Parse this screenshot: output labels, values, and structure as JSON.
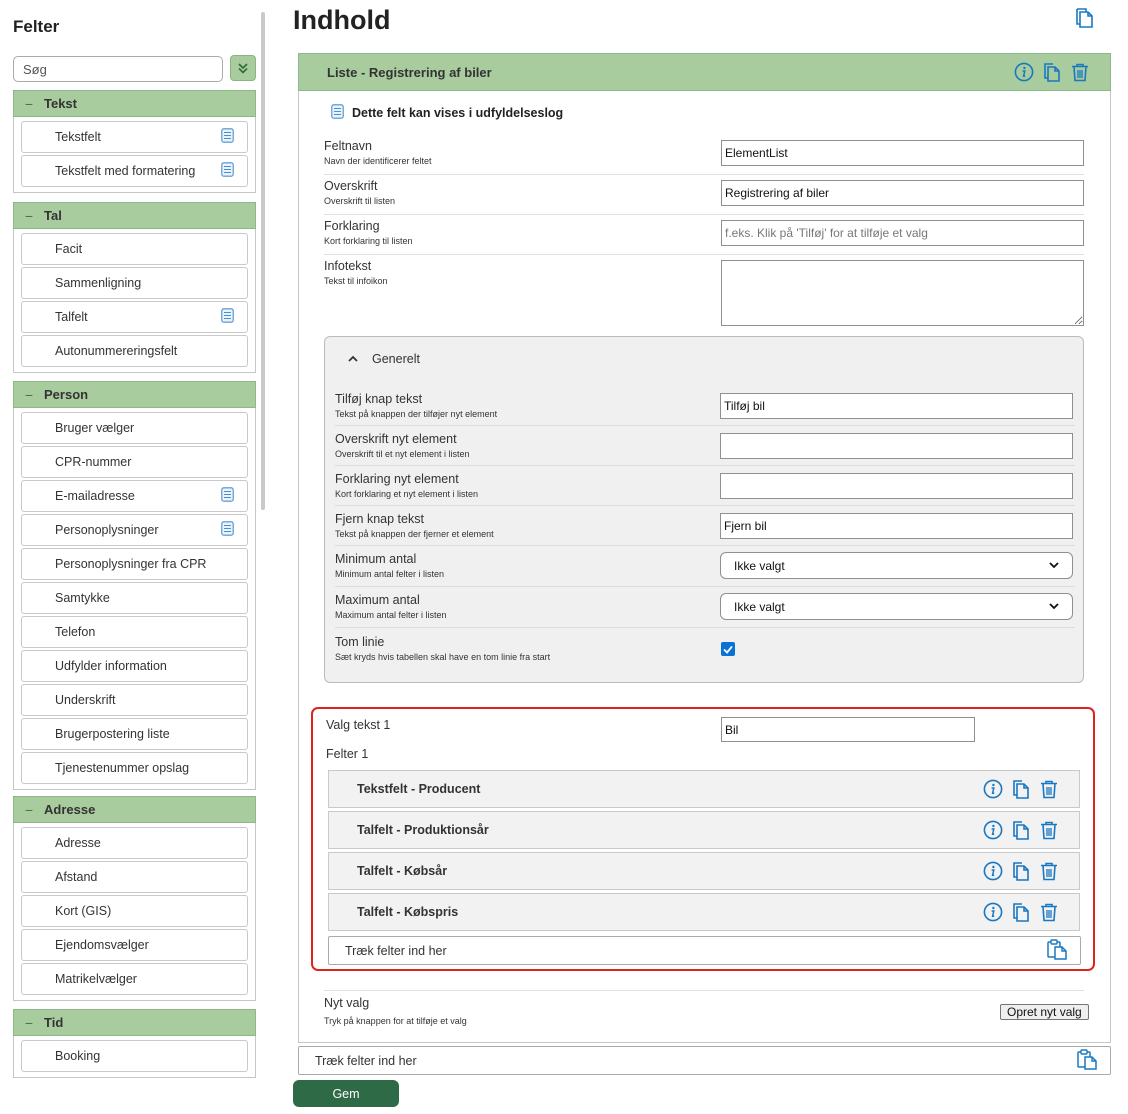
{
  "sidebar": {
    "title": "Felter",
    "search_placeholder": "Søg",
    "groups": [
      {
        "label": "Tekst",
        "items": [
          {
            "label": "Tekstfelt",
            "log": true
          },
          {
            "label": "Tekstfelt med formatering",
            "log": true
          }
        ]
      },
      {
        "label": "Tal",
        "items": [
          {
            "label": "Facit"
          },
          {
            "label": "Sammenligning"
          },
          {
            "label": "Talfelt",
            "log": true
          },
          {
            "label": "Autonummereringsfelt"
          }
        ]
      },
      {
        "label": "Person",
        "items": [
          {
            "label": "Bruger vælger"
          },
          {
            "label": "CPR-nummer"
          },
          {
            "label": "E-mailadresse",
            "log": true
          },
          {
            "label": "Personoplysninger",
            "log": true
          },
          {
            "label": "Personoplysninger fra CPR"
          },
          {
            "label": "Samtykke"
          },
          {
            "label": "Telefon"
          },
          {
            "label": "Udfylder information"
          },
          {
            "label": "Underskrift"
          },
          {
            "label": "Brugerpostering liste"
          },
          {
            "label": "Tjenestenummer opslag"
          }
        ]
      },
      {
        "label": "Adresse",
        "items": [
          {
            "label": "Adresse"
          },
          {
            "label": "Afstand"
          },
          {
            "label": "Kort (GIS)"
          },
          {
            "label": "Ejendomsvælger"
          },
          {
            "label": "Matrikelvælger"
          }
        ]
      },
      {
        "label": "Tid",
        "items": [
          {
            "label": "Booking"
          }
        ]
      }
    ]
  },
  "main": {
    "title": "Indhold",
    "list": {
      "title": "Liste - Registrering af biler",
      "log_notice": "Dette felt kan vises i udfyldelseslog",
      "fields": {
        "feltnavn": {
          "label": "Feltnavn",
          "sub": "Navn der identificerer feltet",
          "value": "ElementList"
        },
        "overskrift": {
          "label": "Overskrift",
          "sub": "Overskrift til listen",
          "value": "Registrering af biler"
        },
        "forklaring": {
          "label": "Forklaring",
          "sub": "Kort forklaring til listen",
          "placeholder": "f.eks. Klik på 'Tilføj' for at tilføje et valg"
        },
        "infotekst": {
          "label": "Infotekst",
          "sub": "Tekst til infoikon",
          "value": ""
        }
      },
      "general": {
        "title": "Generelt",
        "tilfoej": {
          "label": "Tilføj knap tekst",
          "sub": "Tekst på knappen der tilføjer nyt element",
          "value": "Tilføj bil"
        },
        "overskrift_nyt": {
          "label": "Overskrift nyt element",
          "sub": "Overskrift til et nyt element i listen",
          "value": ""
        },
        "forklaring_nyt": {
          "label": "Forklaring nyt element",
          "sub": "Kort forklaring et nyt element i listen",
          "value": ""
        },
        "fjern": {
          "label": "Fjern knap tekst",
          "sub": "Tekst på knappen der fjerner et element",
          "value": "Fjern bil"
        },
        "minimum": {
          "label": "Minimum antal",
          "sub": "Minimum antal felter i listen",
          "value": "Ikke valgt"
        },
        "maximum": {
          "label": "Maximum antal",
          "sub": "Maximum antal felter i listen",
          "value": "Ikke valgt"
        },
        "tom_linie": {
          "label": "Tom linie",
          "sub": "Sæt kryds hvis tabellen skal have en tom linie fra start",
          "checked": true
        }
      },
      "choice": {
        "label": "Valg tekst 1",
        "value": "Bil",
        "fields_label": "Felter 1",
        "items": [
          "Tekstfelt - Producent",
          "Talfelt - Produktionsår",
          "Talfelt - Købsår",
          "Talfelt - Købspris"
        ],
        "drop_label": "Træk felter ind her"
      },
      "new_choice": {
        "label": "Nyt valg",
        "sub": "Tryk på knappen for at tilføje et valg",
        "button": "Opret nyt valg"
      }
    },
    "drop_label": "Træk felter ind her",
    "save_button": "Gem"
  },
  "colors": {
    "accent_green": "#a9cc9f",
    "icon_blue": "#1a78c2",
    "save_green": "#2e6a45",
    "highlight_red": "#e0221c"
  }
}
